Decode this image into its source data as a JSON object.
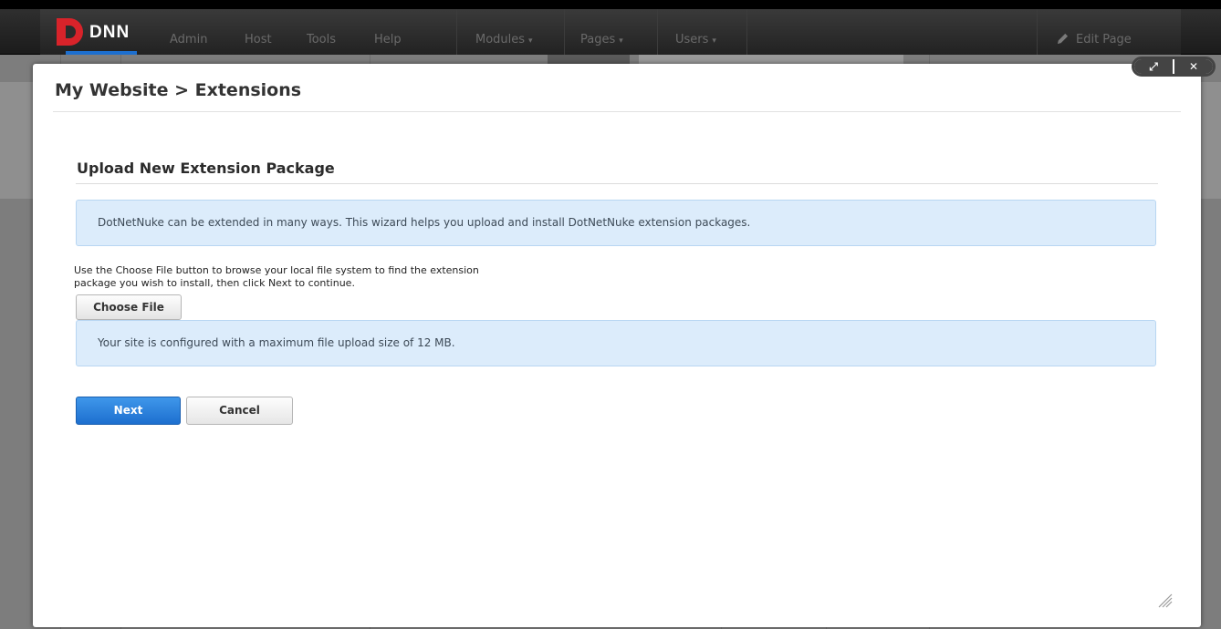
{
  "control_bar": {
    "logo_text": "DNN",
    "menu": [
      {
        "label": "Admin"
      },
      {
        "label": "Host"
      },
      {
        "label": "Tools"
      },
      {
        "label": "Help"
      },
      {
        "label": "Modules"
      },
      {
        "label": "Pages"
      },
      {
        "label": "Users"
      }
    ],
    "dropdown_caret": "▾",
    "edit_page_label": "Edit Page"
  },
  "modal": {
    "title": "My Website > Extensions",
    "window_controls": {
      "maximize_glyph": "⤢",
      "close_glyph": "✕"
    },
    "section_title": "Upload New Extension Package",
    "intro_info": "DotNetNuke can be extended in many ways. This wizard helps you upload and install DotNetNuke extension packages.",
    "instructions_line1": "Use the Choose File button to browse your local file system to find the extension",
    "instructions_line2": "package you wish to install, then click Next to continue.",
    "choose_file_label": "Choose File",
    "size_info": "Your site is configured with a maximum file upload size of 12 MB.",
    "next_label": "Next",
    "cancel_label": "Cancel"
  },
  "colors": {
    "primary_button": "#1d6fcf",
    "info_background": "#dcecfb",
    "logo_red": "#d8232a",
    "control_bar": "#222222"
  },
  "icons": [
    "dnn-logo-icon",
    "pencil-icon",
    "maximize-icon",
    "close-icon",
    "resize-grip-icon"
  ]
}
